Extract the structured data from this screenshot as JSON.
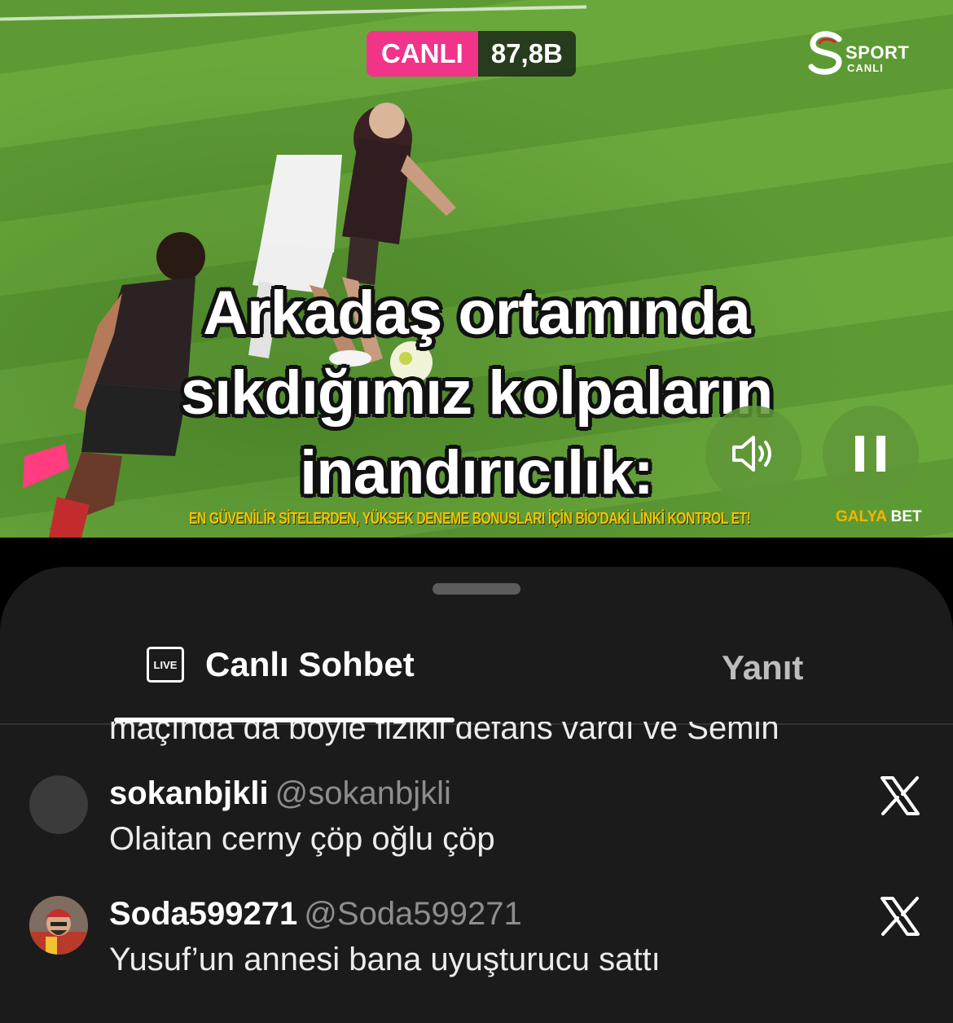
{
  "video": {
    "live_label": "CANLI",
    "viewer_count": "87,8B",
    "channel_brand": "SPORT",
    "channel_sub": "CANLI",
    "caption_lines": [
      "Arkadaş ortamında",
      "sıkdığımız kolpaların",
      "inandırıcılık:"
    ],
    "ad_text": "EN GÜVENİLİR SİTELERDEN, YÜKSEK DENEME BONUSLARI İÇİN BİO'DAKİ LİNKİ KONTROL ET!",
    "ad_brand_part1": "GALYA",
    "ad_brand_part2": "BET",
    "volume_icon": "speaker-icon",
    "pause_icon": "pause-icon"
  },
  "sheet": {
    "tabs": [
      {
        "label": "Canlı Sohbet",
        "icon": "live-icon",
        "icon_text": "LIVE",
        "active": true
      },
      {
        "label": "Yanıt",
        "active": false
      }
    ],
    "partial_message": "maçında da böyle fizikli defans vardı ve Semih",
    "messages": [
      {
        "name": "sokanbjkli",
        "handle": "@sokanbjkli",
        "text": "Olaitan cerny çöp oğlu çöp",
        "avatar": "default-avatar"
      },
      {
        "name": "Soda599271",
        "handle": "@Soda599271",
        "text": "Yusuf’un annesi bana uyuşturucu sattı",
        "avatar": "photo-avatar"
      }
    ]
  },
  "colors": {
    "live_pink": "#f2338a",
    "sheet_bg": "#1b1b1b",
    "ad_yellow": "#f4c400"
  }
}
